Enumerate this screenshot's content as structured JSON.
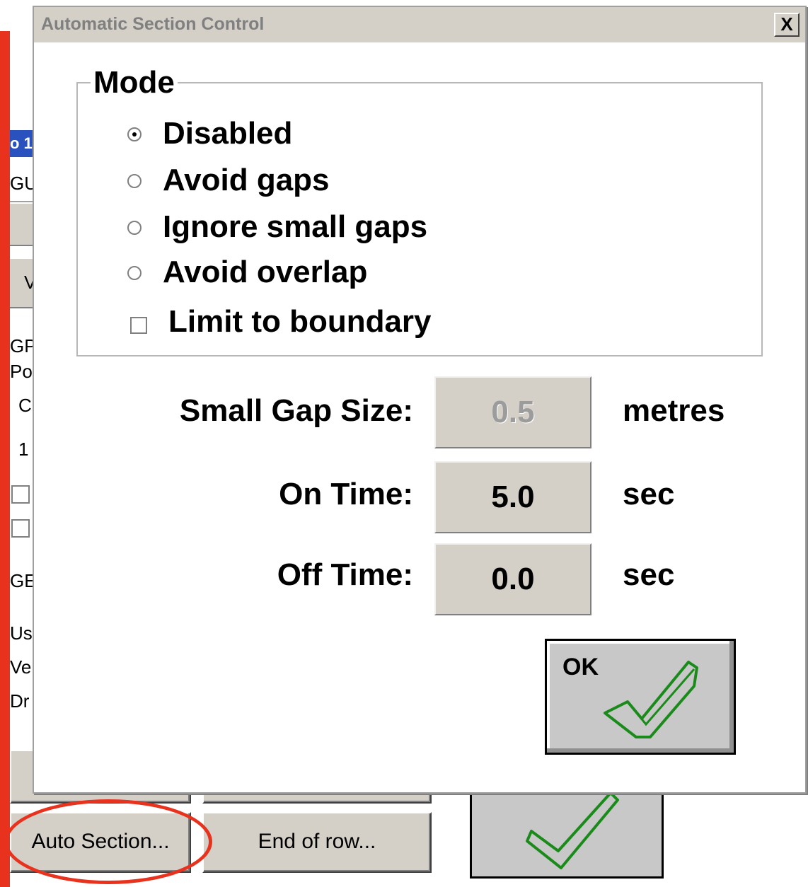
{
  "background_window": {
    "fragments": {
      "blue_tab": "o 1",
      "gu": "GU",
      "w": "V",
      "gp": "GP",
      "po": "Po",
      "c": "C",
      "one": "1",
      "ge": "GE",
      "us": "Us",
      "ve": "Ve",
      "dr": "Dr"
    },
    "auto_section_label": "Auto Section...",
    "end_of_row_label": "End of row..."
  },
  "dialog": {
    "title": "Automatic Section Control",
    "close_label": "X",
    "mode": {
      "legend": "Mode",
      "options": [
        {
          "label": "Disabled",
          "selected": true
        },
        {
          "label": "Avoid gaps",
          "selected": false
        },
        {
          "label": "Ignore small gaps",
          "selected": false
        },
        {
          "label": "Avoid overlap",
          "selected": false
        }
      ],
      "limit_to_boundary": {
        "label": "Limit to boundary",
        "checked": false
      }
    },
    "fields": {
      "small_gap": {
        "label": "Small Gap Size:",
        "value": "0.5",
        "unit": "metres",
        "disabled": true
      },
      "on_time": {
        "label": "On Time:",
        "value": "5.0",
        "unit": "sec"
      },
      "off_time": {
        "label": "Off Time:",
        "value": "0.0",
        "unit": "sec"
      }
    },
    "ok_label": "OK"
  },
  "colors": {
    "annotation_red": "#e8321e",
    "check_green": "#1a8a1a",
    "button_face": "#d4d0c8"
  }
}
